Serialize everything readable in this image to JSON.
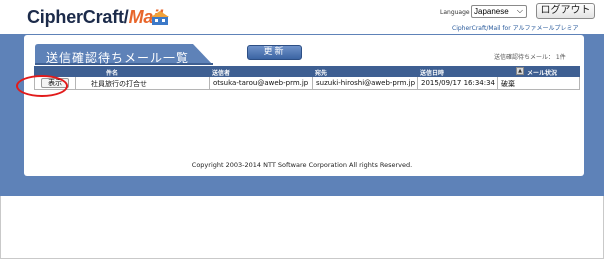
{
  "header": {
    "logo_main": "CipherCraft/",
    "logo_accent": "Mail",
    "language_label": "Language",
    "language_value": "Japanese",
    "logout_label": "ログアウト",
    "product_line": "CipherCraft/Mail for アルファメールプレミア"
  },
  "panel": {
    "title": "送信確認待ちメール一覧",
    "refresh_label": "更新",
    "pending_count": "送信確認待ちメール： 1件"
  },
  "table": {
    "columns": [
      "件名",
      "送信者",
      "宛先",
      "送信日時",
      "メール状況"
    ],
    "sort_icon": "▲",
    "rows": [
      {
        "action": "表示",
        "subject": "社員旅行の打合せ",
        "sender": "otsuka-tarou@aweb-prm.jp",
        "recipient": "suzuki-hiroshi@aweb-prm.jp",
        "sent_at": "2015/09/17 16:34:34",
        "status": "破棄"
      }
    ]
  },
  "footer": {
    "copyright": "Copyright 2003-2014 NTT Software Corporation All rights Reserved."
  },
  "colors": {
    "band": "#5e82b8",
    "header_row": "#3e5f92",
    "highlight": "#e21b1b",
    "logo_accent": "#e8662b"
  }
}
